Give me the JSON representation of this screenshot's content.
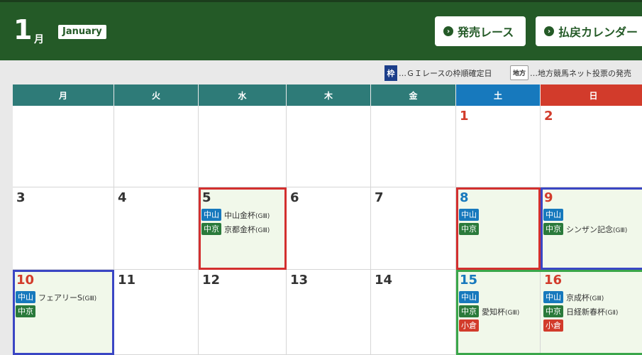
{
  "header": {
    "month_number": "1",
    "month_unit": "月",
    "month_english": "January",
    "buttons": [
      {
        "label": "発売レース",
        "icon": "chevron-right-circle-icon"
      },
      {
        "label": "払戻カレンダー",
        "icon": "chevron-right-circle-icon"
      }
    ]
  },
  "legend": [
    {
      "badge": "枠",
      "text": "…ＧＩレースの枠順確定日"
    },
    {
      "badge": "地方",
      "text": "…地方競馬ネット投票の発売"
    }
  ],
  "weekdays": [
    "月",
    "火",
    "水",
    "木",
    "金",
    "土",
    "日"
  ],
  "colors": {
    "header_bg": "#245a27",
    "weekday_bg": "#2e7b78",
    "saturday_bg": "#1779bd",
    "sunday_bg": "#d23b2b",
    "nakayama_tag": "#1779bd",
    "chukyo_tag": "#2a7a3b",
    "kokura_tag": "#d23b2b",
    "frame_red": "#d32f2f",
    "frame_blue": "#3a46c4",
    "frame_green": "#3aa64a"
  },
  "days": [
    {
      "day": "1"
    },
    {
      "day": "2"
    },
    {
      "day": "3"
    },
    {
      "day": "4"
    },
    {
      "day": "5",
      "events": [
        {
          "venue": "中山",
          "race": "中山金杯",
          "grade": "(GⅢ)"
        },
        {
          "venue": "中京",
          "race": "京都金杯",
          "grade": "(GⅢ)"
        }
      ]
    },
    {
      "day": "6"
    },
    {
      "day": "7"
    },
    {
      "day": "8",
      "events": [
        {
          "venue": "中山"
        },
        {
          "venue": "中京"
        }
      ]
    },
    {
      "day": "9",
      "events": [
        {
          "venue": "中山"
        },
        {
          "venue": "中京",
          "race": "シンザン記念",
          "grade": "(GⅢ)"
        }
      ]
    },
    {
      "day": "10",
      "events": [
        {
          "venue": "中山",
          "race": "フェアリーS",
          "grade": "(GⅢ)"
        },
        {
          "venue": "中京"
        }
      ]
    },
    {
      "day": "11"
    },
    {
      "day": "12"
    },
    {
      "day": "13"
    },
    {
      "day": "14"
    },
    {
      "day": "15",
      "events": [
        {
          "venue": "中山"
        },
        {
          "venue": "中京",
          "race": "愛知杯",
          "grade": "(GⅢ)"
        },
        {
          "venue": "小倉"
        }
      ]
    },
    {
      "day": "16",
      "events": [
        {
          "venue": "中山",
          "race": "京成杯",
          "grade": "(GⅢ)"
        },
        {
          "venue": "中京",
          "race": "日経新春杯",
          "grade": "(GⅡ)"
        },
        {
          "venue": "小倉"
        }
      ]
    }
  ]
}
